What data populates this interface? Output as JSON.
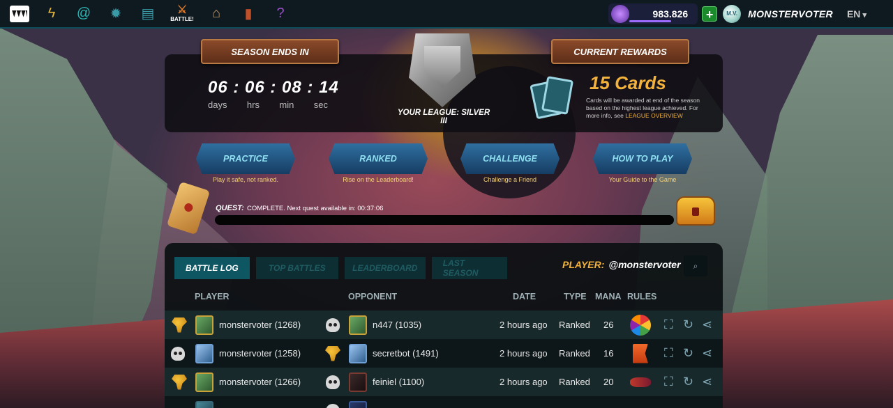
{
  "nav": {
    "icons": [
      "logo-icon",
      "lightning-icon",
      "swirl-icon",
      "potion-icon",
      "cards-icon",
      "battle-icon",
      "shop-icon",
      "guild-icon",
      "help-icon"
    ],
    "battle_label": "BATTLE!"
  },
  "account": {
    "balance": "983.826",
    "plus": "+",
    "avatar_text": "M.V.",
    "username": "MONSTERVOTER",
    "language": "EN"
  },
  "season": {
    "banner": "SEASON ENDS IN",
    "timer": "06 : 06 : 08 : 14",
    "labels": [
      "days",
      "hrs",
      "min",
      "sec"
    ]
  },
  "league": {
    "text": "YOUR LEAGUE: SILVER III"
  },
  "rewards": {
    "banner": "CURRENT REWARDS",
    "title": "15 Cards",
    "desc": "Cards will be awarded at end of the season based on the highest league achieved. For more info, see ",
    "link": "LEAGUE OVERVIEW"
  },
  "modes": [
    {
      "label": "PRACTICE",
      "sub": "Play it safe, not ranked."
    },
    {
      "label": "RANKED",
      "sub": "Rise on the Leaderboard!"
    },
    {
      "label": "CHALLENGE",
      "sub": "Challenge a Friend"
    },
    {
      "label": "HOW TO PLAY",
      "sub": "Your Guide to the Game"
    }
  ],
  "quest": {
    "label": "QUEST:",
    "text": "COMPLETE. Next quest available in: 00:37:06"
  },
  "log": {
    "tabs": [
      "BATTLE LOG",
      "TOP BATTLES",
      "LEADERBOARD",
      "LAST SEASON"
    ],
    "player_label": "PLAYER:",
    "player_name": "@monstervoter",
    "headers": {
      "player": "PLAYER",
      "opponent": "OPPONENT",
      "date": "DATE",
      "type": "TYPE",
      "mana": "MANA",
      "rules": "RULES"
    },
    "rows": [
      {
        "player": "monstervoter (1268)",
        "opponent": "n447 (1035)",
        "date": "2 hours ago",
        "type": "Ranked",
        "mana": "26"
      },
      {
        "player": "monstervoter (1258)",
        "opponent": "secretbot (1491)",
        "date": "2 hours ago",
        "type": "Ranked",
        "mana": "16"
      },
      {
        "player": "monstervoter (1266)",
        "opponent": "feiniel (1100)",
        "date": "2 hours ago",
        "type": "Ranked",
        "mana": "20"
      }
    ]
  },
  "colors": {
    "accent": "#f2b23c",
    "tab_active": "#0f5663",
    "topbar": "#0f1a20"
  }
}
